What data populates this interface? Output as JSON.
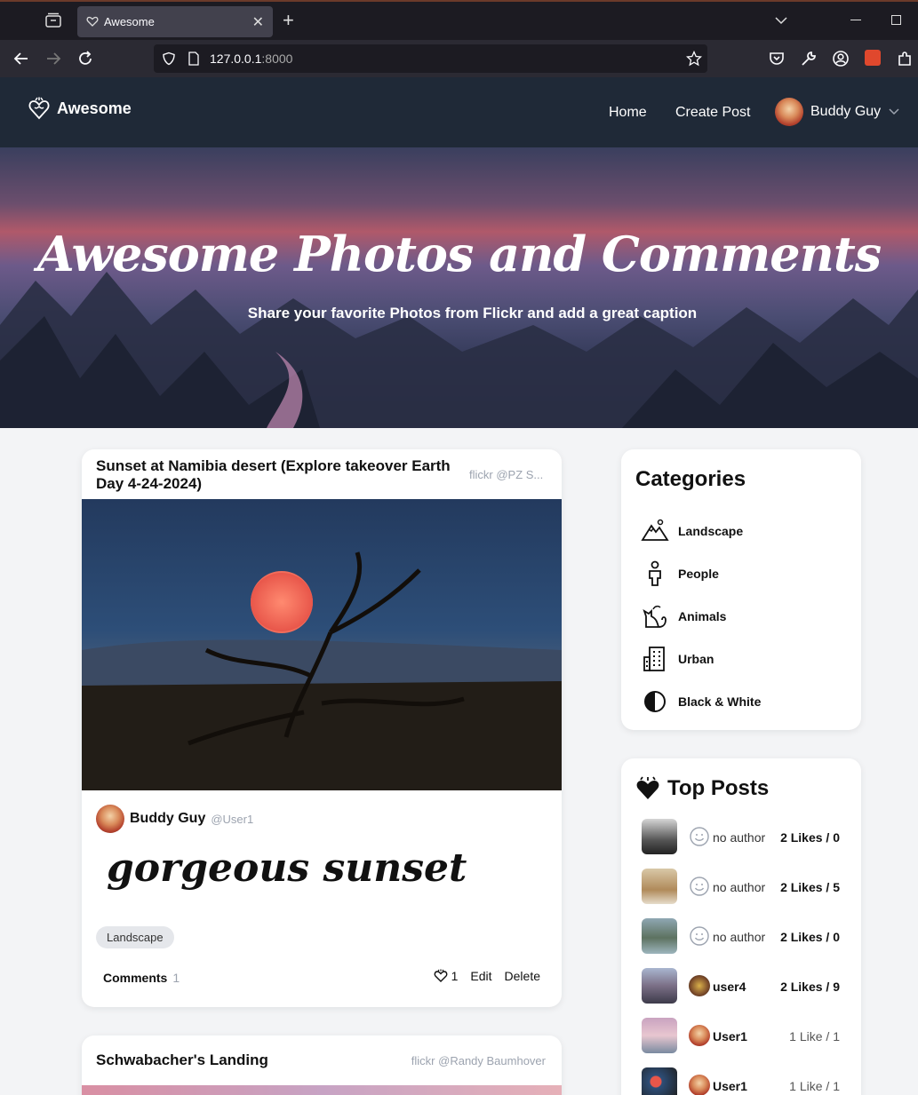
{
  "browser": {
    "tab_title": "Awesome",
    "url_host": "127.0.0.1",
    "url_port": ":8000"
  },
  "header": {
    "logo_text": "Awesome",
    "nav": {
      "home": "Home",
      "create_post": "Create Post"
    },
    "user_name": "Buddy Guy"
  },
  "hero": {
    "title": "Awesome Photos and Comments",
    "subtitle": "Share your favorite Photos from Flickr and add a great caption"
  },
  "posts": [
    {
      "title": "Sunset at Namibia desert (Explore takeover Earth Day 4-24-2024)",
      "credit": "flickr @PZ S...",
      "author_name": "Buddy Guy",
      "author_handle": "@User1",
      "caption": "gorgeous sunset",
      "tag": "Landscape",
      "comments_label": "Comments",
      "comments_count": "1",
      "likes": "1",
      "edit_label": "Edit",
      "delete_label": "Delete"
    },
    {
      "title": "Schwabacher's Landing",
      "credit": "flickr @Randy Baumhover"
    }
  ],
  "categories": {
    "title": "Categories",
    "items": [
      {
        "label": "Landscape",
        "icon": "mountain-icon"
      },
      {
        "label": "People",
        "icon": "person-icon"
      },
      {
        "label": "Animals",
        "icon": "cat-icon"
      },
      {
        "label": "Urban",
        "icon": "building-icon"
      },
      {
        "label": "Black & White",
        "icon": "contrast-icon"
      }
    ]
  },
  "top_posts": {
    "title": "Top Posts",
    "items": [
      {
        "author": "no author",
        "likes": "2 Likes / 0"
      },
      {
        "author": "no author",
        "likes": "2 Likes / 5"
      },
      {
        "author": "no author",
        "likes": "2 Likes / 0"
      },
      {
        "author": "user4",
        "likes": "2 Likes / 9"
      },
      {
        "author": "User1",
        "likes": "1 Like / 1"
      },
      {
        "author": "User1",
        "likes": "1 Like / 1"
      }
    ]
  }
}
